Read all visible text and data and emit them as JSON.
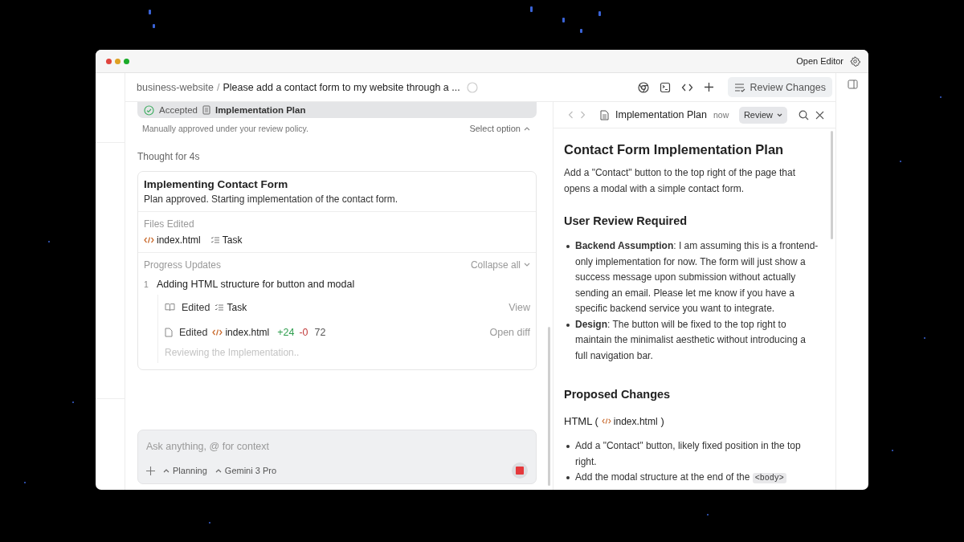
{
  "window": {
    "open_editor": "Open Editor"
  },
  "breadcrumb": {
    "project": "business-website",
    "separator": "/",
    "title": "Please add a contact form to my website through a ..."
  },
  "toolbar": {
    "review_button": "Review Changes"
  },
  "chat": {
    "accepted": {
      "status": "Accepted",
      "artifact": "Implementation Plan"
    },
    "policy_note": "Manually approved under your review policy.",
    "select_option": "Select option",
    "thought": "Thought for 4s",
    "task": {
      "title": "Implementing Contact Form",
      "summary": "Plan approved. Starting implementation of the contact form.",
      "files_label": "Files Edited",
      "files": [
        {
          "kind": "code",
          "name": "index.html"
        },
        {
          "kind": "task",
          "name": "Task"
        }
      ],
      "progress_label": "Progress Updates",
      "collapse": "Collapse all",
      "steps": [
        {
          "number": "1",
          "title": "Adding HTML structure for button and modal",
          "events": [
            {
              "kind": "task",
              "verb": "Edited",
              "file": "Task",
              "action": "View"
            },
            {
              "kind": "code",
              "verb": "Edited",
              "file": "index.html",
              "added": "+24",
              "removed": "-0",
              "lines": "72",
              "action": "Open diff"
            }
          ],
          "status": "Reviewing the Implementation.."
        }
      ]
    }
  },
  "composer": {
    "placeholder": "Ask anything, @ for context",
    "mode": "Planning",
    "model": "Gemini 3 Pro"
  },
  "document": {
    "title": "Implementation Plan",
    "time": "now",
    "review": "Review",
    "blocks": [
      {
        "kind": "h1",
        "text": "Contact Form Implementation Plan"
      },
      {
        "kind": "p",
        "text": "Add a \"Contact\" button to the top right of the page that opens a modal with a simple contact form."
      },
      {
        "kind": "h2",
        "text": "User Review Required"
      },
      {
        "kind": "ul",
        "items": [
          {
            "text": "**Backend Assumption**: I am assuming this is a frontend-only implementation for now. The form will just show a success message upon submission without actually sending an email. Please let me know if you have a specific backend service you want to integrate."
          },
          {
            "text": "**Design**: The button will be fixed to the top right to maintain the minimalist aesthetic without introducing a full navigation bar."
          }
        ]
      },
      {
        "kind": "h2",
        "text": "Proposed Changes"
      },
      {
        "kind": "h3",
        "prefix": "HTML (",
        "file": "index.html",
        "suffix": ")"
      },
      {
        "kind": "ul",
        "items": [
          {
            "text": "Add a \"Contact\" button, likely fixed position in the top right."
          },
          {
            "text": "Add the modal structure at the end of the",
            "code": "<body>"
          }
        ]
      }
    ]
  }
}
